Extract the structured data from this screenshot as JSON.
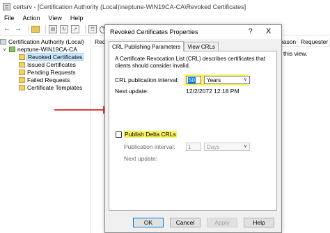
{
  "window": {
    "title": "certsrv - [Certification Authority (Local)\\neptune-WIN19CA-CA\\Revoked Certificates]"
  },
  "menu": [
    "File",
    "Action",
    "View",
    "Help"
  ],
  "toolbar": {
    "icons": [
      "back-arrow-icon",
      "forward-arrow-icon",
      "up-folder-icon",
      "show-hide-tree-icon",
      "refresh-icon",
      "export-list-icon",
      "properties-icon",
      "help-icon"
    ]
  },
  "tree": {
    "root": "Certification Authority (Local)",
    "ca": "neptune-WIN19CA-CA",
    "items": [
      "Revoked Certificates",
      "Issued Certificates",
      "Pending Requests",
      "Failed Requests",
      "Certificate Templates"
    ]
  },
  "list": {
    "columns": [
      "Requ",
      "eason",
      "Requester N"
    ],
    "empty_message": "in this view."
  },
  "dialog": {
    "title": "Revoked Certificates Properties",
    "help": "?",
    "close": "X",
    "tabs": [
      "CRL Publishing Parameters",
      "View CRLs"
    ],
    "description": "A Certificate Revocation List (CRL) describes certificates that clients should consider invalid.",
    "crl_interval_label": "CRL publication interval:",
    "crl_interval_value": "50",
    "crl_interval_unit": "Years",
    "next_update_label": "Next update:",
    "next_update_value": "12/2/2072 12:18 PM",
    "publish_delta_label": "Publish Delta CRLs",
    "publish_delta_checked": false,
    "delta_interval_label": "Publication interval:",
    "delta_interval_value": "1",
    "delta_interval_unit": "Days",
    "delta_next_update_label": "Next update:",
    "buttons": [
      "OK",
      "Cancel",
      "Apply",
      "Help"
    ]
  },
  "colors": {
    "highlight": "#f7f25a",
    "annotation_arrow": "#e03a3a",
    "selection": "#cce8ff"
  }
}
